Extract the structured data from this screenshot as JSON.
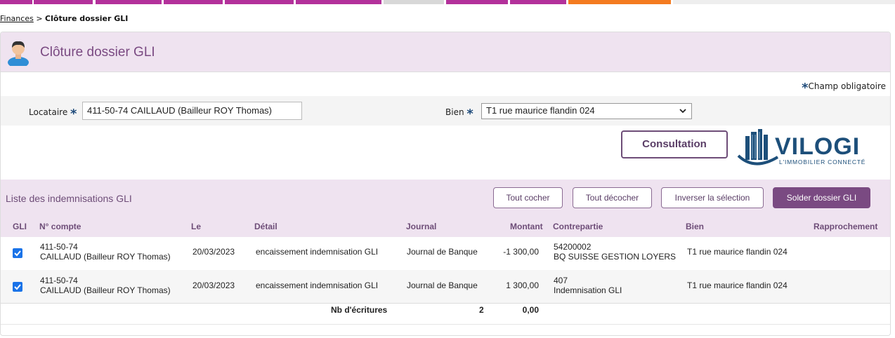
{
  "breadcrumb": {
    "parent": "Finances",
    "separator": " > ",
    "current": "Clôture dossier GLI"
  },
  "page": {
    "title": "Clôture dossier GLI"
  },
  "form": {
    "required_star": "*",
    "required_note": "Champ obligatoire",
    "locataire_label": "Locataire",
    "locataire_value": "411-50-74 CAILLAUD (Bailleur ROY Thomas)",
    "bien_label": "Bien",
    "bien_value": "T1 rue maurice flandin 024"
  },
  "actions": {
    "consultation": "Consultation"
  },
  "logo": {
    "name": "VILOGI",
    "tagline": "L'IMMOBILIER CONNECTÉ"
  },
  "list": {
    "title": "Liste des indemnisations GLI",
    "buttons": {
      "check_all": "Tout cocher",
      "uncheck_all": "Tout décocher",
      "invert": "Inverser la sélection",
      "solder": "Solder dossier GLI"
    },
    "columns": {
      "gli": "GLI",
      "compte": "N° compte",
      "le": "Le",
      "detail": "Détail",
      "journal": "Journal",
      "montant": "Montant",
      "contrepartie": "Contrepartie",
      "bien": "Bien",
      "rapprochement": "Rapprochement"
    },
    "rows": [
      {
        "checked": true,
        "compte_line1": "411-50-74",
        "compte_line2": "CAILLAUD (Bailleur ROY Thomas)",
        "le": "20/03/2023",
        "detail": "encaissement indemnisation GLI",
        "journal": "Journal de Banque",
        "montant": "-1 300,00",
        "contrepartie_line1": "54200002",
        "contrepartie_line2": "BQ SUISSE GESTION LOYERS",
        "bien": "T1 rue maurice flandin 024",
        "rapprochement": ""
      },
      {
        "checked": true,
        "compte_line1": "411-50-74",
        "compte_line2": "CAILLAUD (Bailleur ROY Thomas)",
        "le": "20/03/2023",
        "detail": "encaissement indemnisation GLI",
        "journal": "Journal de Banque",
        "montant": "1 300,00",
        "contrepartie_line1": "407",
        "contrepartie_line2": "Indemnisation GLI",
        "bien": "T1 rue maurice flandin 024",
        "rapprochement": ""
      }
    ],
    "footer": {
      "label": "Nb d'écritures",
      "count": "2",
      "total": "0,00"
    }
  },
  "colors": {
    "accent": "#7a4a82",
    "header_bg": "#efe3f0",
    "checkbox": "#1a73e8",
    "nav_magenta": "#b3319b",
    "nav_orange": "#f47b20"
  }
}
